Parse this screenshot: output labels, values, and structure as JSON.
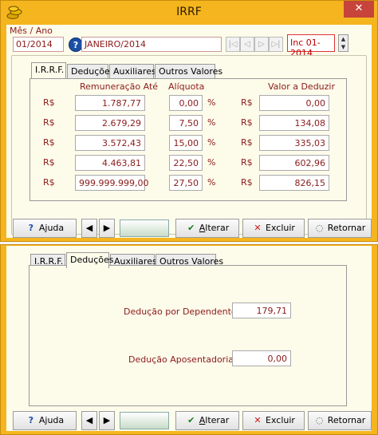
{
  "window": {
    "title": "IRRF",
    "close_glyph": "✕",
    "app_icon": "coins-icon"
  },
  "header": {
    "mes_label": "Mês / Ano",
    "mes_value": "01/2014",
    "help_glyph": "?",
    "mes_description": "JANEIRO/2014",
    "nav_buttons": [
      "|◁",
      "◁",
      "▷",
      "▷|"
    ],
    "inc_value": "Inc 01-2014"
  },
  "tabs": [
    "I.R.R.F.",
    "Deduções",
    "Auxiliares",
    "Outros Valores"
  ],
  "irrf_table": {
    "col_remuneracao": "Remuneração Até",
    "col_aliquota": "Alíquota",
    "col_deduzir": "Valor a Deduzir",
    "currency": "R$",
    "percent": "%",
    "rows": [
      {
        "remuneracao": "1.787,77",
        "aliquota": "0,00",
        "deduzir": "0,00"
      },
      {
        "remuneracao": "2.679,29",
        "aliquota": "7,50",
        "deduzir": "134,08"
      },
      {
        "remuneracao": "3.572,43",
        "aliquota": "15,00",
        "deduzir": "335,03"
      },
      {
        "remuneracao": "4.463,81",
        "aliquota": "22,50",
        "deduzir": "602,96"
      },
      {
        "remuneracao": "999.999.999,00",
        "aliquota": "27,50",
        "deduzir": "826,15"
      }
    ]
  },
  "toolbar": {
    "ajuda": "Ajuda",
    "prev_glyph": "🡄",
    "next_glyph": "🡆",
    "alterar_first": "A",
    "alterar_rest": "lterar",
    "excluir": "Excluir",
    "retornar": "Retornar"
  },
  "deducoes": {
    "dependente_label": "Dedução por Dependente R$",
    "dependente_value": "179,71",
    "aposentadoria_label": "Dedução Aposentadoria R$",
    "aposentadoria_value": "0,00"
  },
  "colors": {
    "window_frame": "#f5b51e",
    "client_bg": "#fdfbea",
    "label_text": "#8b1a1a",
    "inc_border": "#dd3333"
  }
}
